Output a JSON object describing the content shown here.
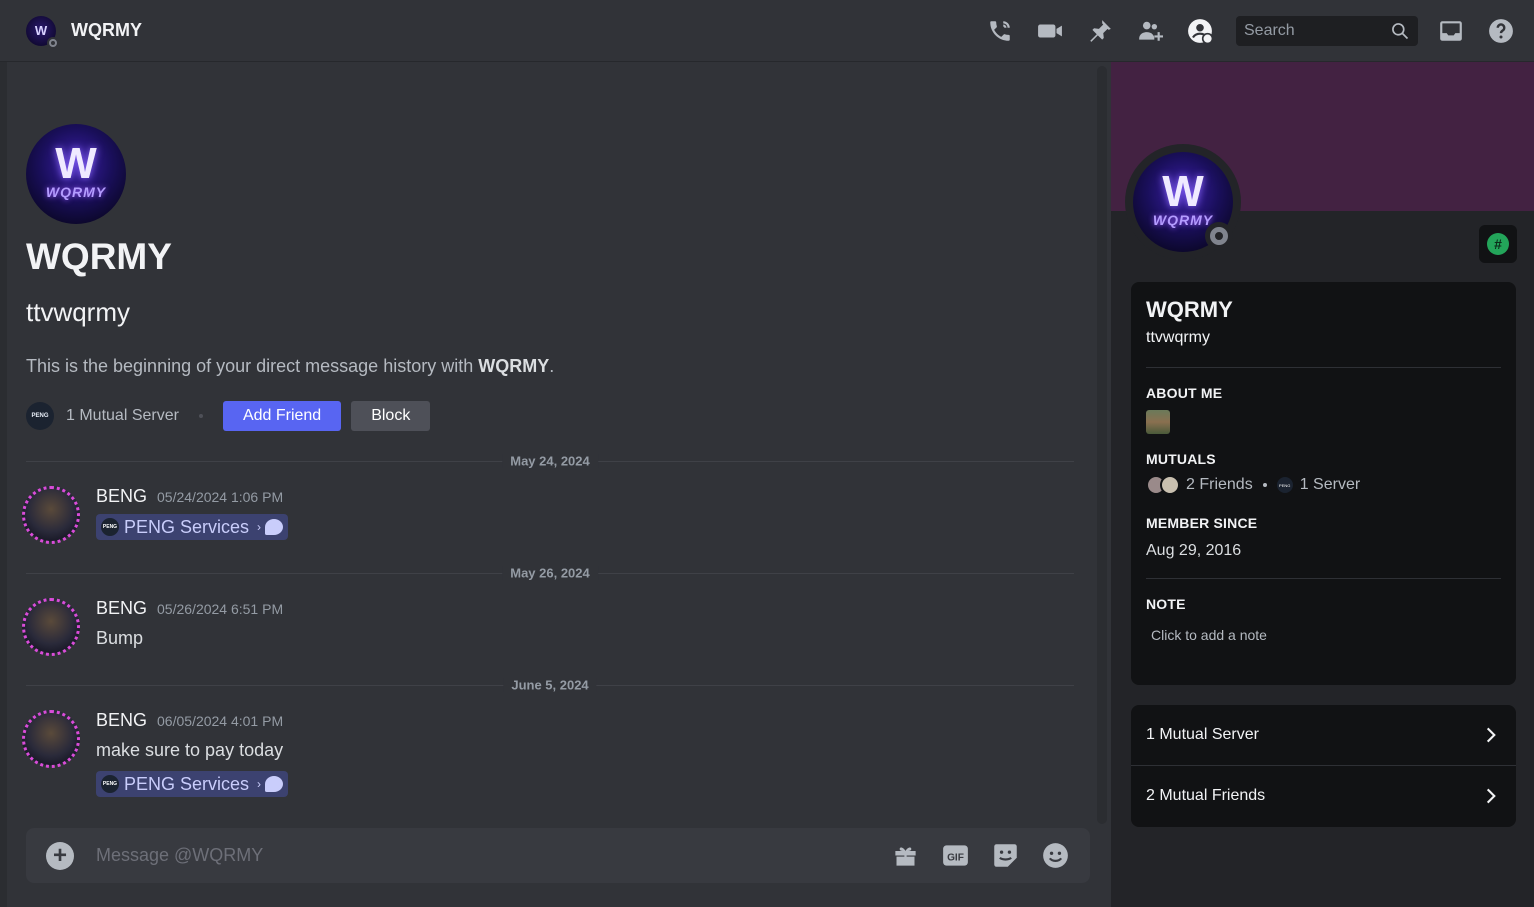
{
  "header": {
    "title": "WQRMY",
    "avatar_initial": "W",
    "search_placeholder": "Search"
  },
  "intro": {
    "display_name": "WQRMY",
    "username": "ttvwqrmy",
    "beginning_prefix": "This is the beginning of your direct message history with ",
    "beginning_name": "WQRMY",
    "beginning_suffix": ".",
    "mutual_server": "1 Mutual Server",
    "add_friend": "Add Friend",
    "block": "Block",
    "logo_letter": "W",
    "logo_text": "WQRMY"
  },
  "messages": [
    {
      "date": "May 24, 2024",
      "author": "BENG",
      "time": "05/24/2024 1:06 PM",
      "text": "",
      "chip": "PENG Services"
    },
    {
      "date": "May 26, 2024",
      "author": "BENG",
      "time": "05/26/2024 6:51 PM",
      "text": "Bump",
      "chip": ""
    },
    {
      "date": "June 5, 2024",
      "author": "BENG",
      "time": "06/05/2024 4:01 PM",
      "text": "make sure to pay today",
      "chip": "PENG Services"
    }
  ],
  "composer": {
    "placeholder": "Message @WQRMY"
  },
  "profile": {
    "name": "WQRMY",
    "username": "ttvwqrmy",
    "about_label": "ABOUT ME",
    "mutuals_label": "MUTUALS",
    "mutual_friends": "2 Friends",
    "mutual_servers": "1 Server",
    "member_since_label": "MEMBER SINCE",
    "member_since": "Aug 29, 2016",
    "note_label": "NOTE",
    "note_placeholder": "Click to add a note",
    "link_mutual_server": "1 Mutual Server",
    "link_mutual_friends": "2 Mutual Friends",
    "badge_symbol": "#"
  },
  "icons": [
    "voice-call-icon",
    "video-call-icon",
    "pin-icon",
    "add-friends-icon",
    "user-profile-icon",
    "search-icon",
    "inbox-icon",
    "help-icon",
    "gift-icon",
    "gif-icon",
    "sticker-icon",
    "emoji-icon",
    "plus-icon",
    "chevron-right-icon"
  ],
  "colors": {
    "background": "#313338",
    "accent": "#5865f2",
    "banner": "#432242",
    "panel": "#232428",
    "card": "#111214"
  }
}
